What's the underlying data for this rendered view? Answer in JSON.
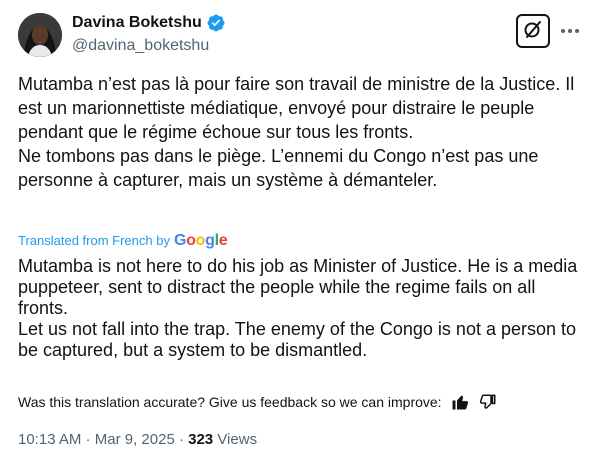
{
  "author": {
    "display_name": "Davina Boketshu",
    "handle": "@davina_boketshu"
  },
  "icons": {
    "verified": "verified-badge-icon",
    "grok": "grok-icon",
    "more": "more-icon",
    "thumbs_up": "thumbs-up-icon",
    "thumbs_down": "thumbs-down-icon"
  },
  "colors": {
    "accent": "#1d9bf0",
    "text": "#0f1419",
    "muted": "#536471"
  },
  "tweet": {
    "original_paragraphs": [
      "Mutamba n’est pas là pour faire son travail de ministre de la Justice. Il est un marionnettiste médiatique, envoyé pour distraire le peuple pendant que le régime échoue sur tous les fronts.",
      "Ne tombons pas dans le piège. L’ennemi du Congo n’est pas une personne à capturer, mais un système à démanteler."
    ],
    "translated_label": "Translated from French by",
    "translator_logo": "Google",
    "translated_paragraphs": [
      "Mutamba is not here to do his job as Minister of Justice. He is a media puppeteer, sent to distract the people while the regime fails on all fronts.",
      "Let us not fall into the trap. The enemy of the Congo is not a person to be captured, but a system to be dismantled."
    ],
    "feedback_prompt": "Was this translation accurate? Give us feedback so we can improve:"
  },
  "meta": {
    "time": "10:13 AM",
    "sep1": " · ",
    "date": "Mar 9, 2025",
    "sep2": " · ",
    "views_count": "323",
    "views_label": " Views"
  }
}
